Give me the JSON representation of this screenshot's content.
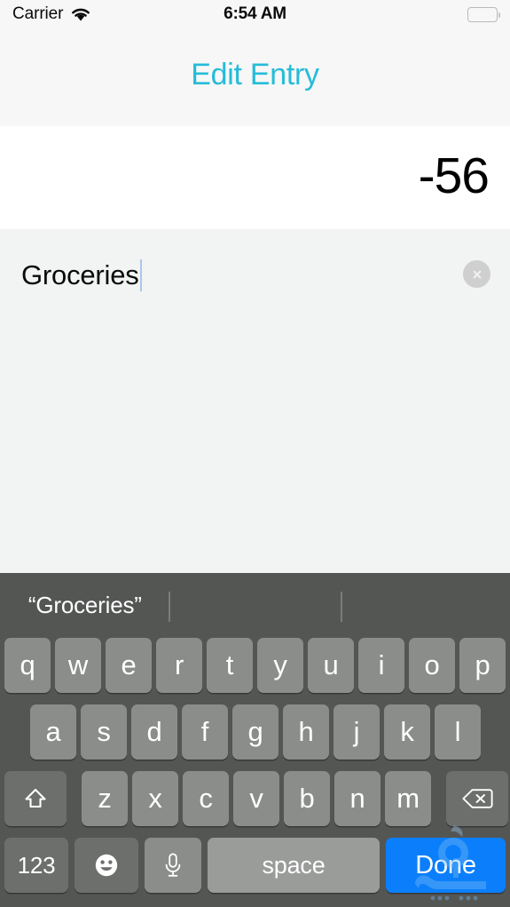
{
  "status_bar": {
    "carrier": "Carrier",
    "wifi_icon": "wifi-icon",
    "time": "6:54 AM",
    "battery_icon": "battery-full-icon"
  },
  "header": {
    "title": "Edit Entry",
    "title_color": "#25bcd8",
    "background": "#f7f7f7"
  },
  "amount_field": {
    "value": "-56",
    "background": "#ffffff"
  },
  "note_field": {
    "value": "Groceries",
    "clear_icon": "clear-circle-icon",
    "caret_color": "#a8c6f0",
    "background": "#f2f3f3"
  },
  "keyboard": {
    "background": "#545654",
    "suggestions": [
      "“Groceries”",
      "",
      ""
    ],
    "row1": [
      "q",
      "w",
      "e",
      "r",
      "t",
      "y",
      "u",
      "i",
      "o",
      "p"
    ],
    "row2": [
      "a",
      "s",
      "d",
      "f",
      "g",
      "h",
      "j",
      "k",
      "l"
    ],
    "row3": [
      "z",
      "x",
      "c",
      "v",
      "b",
      "n",
      "m"
    ],
    "shift_icon": "shift-up-arrow-icon",
    "backspace_icon": "backspace-delete-icon",
    "numeric_label": "123",
    "emoji_icon": "emoji-smiley-icon",
    "dictation_icon": "microphone-icon",
    "space_label": "space",
    "done_label": "Done",
    "done_color": "#0b7ffb",
    "key_color": "#8b8d8b",
    "modifier_key_color": "#6d6f6d"
  },
  "watermark": {
    "icon": "site-watermark-logo"
  }
}
